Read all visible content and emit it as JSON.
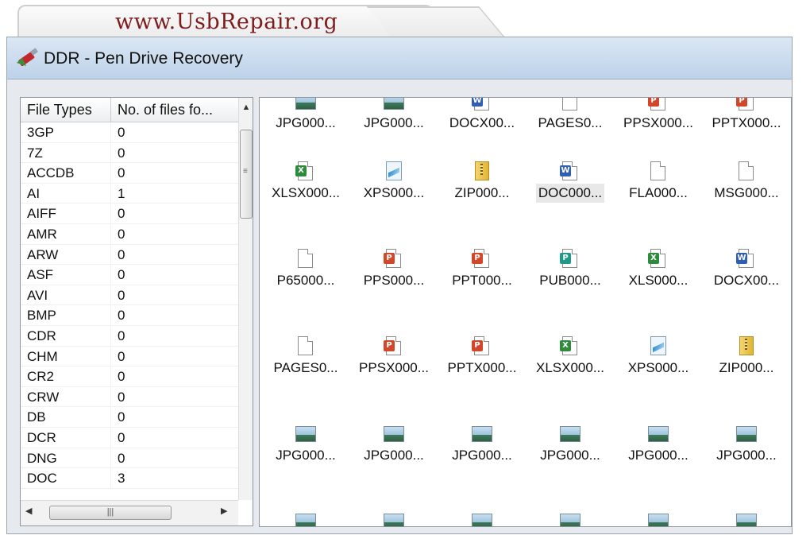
{
  "watermark": "www.UsbRepair.org",
  "window": {
    "title": "DDR - Pen Drive Recovery",
    "icon": "pen-drive-icon"
  },
  "file_types_table": {
    "columns": [
      "File Types",
      "No. of files fo..."
    ],
    "rows": [
      {
        "type": "3GP",
        "count": "0"
      },
      {
        "type": "7Z",
        "count": "0"
      },
      {
        "type": "ACCDB",
        "count": "0"
      },
      {
        "type": "AI",
        "count": "1"
      },
      {
        "type": "AIFF",
        "count": "0"
      },
      {
        "type": "AMR",
        "count": "0"
      },
      {
        "type": "ARW",
        "count": "0"
      },
      {
        "type": "ASF",
        "count": "0"
      },
      {
        "type": "AVI",
        "count": "0"
      },
      {
        "type": "BMP",
        "count": "0"
      },
      {
        "type": "CDR",
        "count": "0"
      },
      {
        "type": "CHM",
        "count": "0"
      },
      {
        "type": "CR2",
        "count": "0"
      },
      {
        "type": "CRW",
        "count": "0"
      },
      {
        "type": "DB",
        "count": "0"
      },
      {
        "type": "DCR",
        "count": "0"
      },
      {
        "type": "DNG",
        "count": "0"
      },
      {
        "type": "DOC",
        "count": "3"
      }
    ]
  },
  "files_view": {
    "rows": [
      [
        {
          "label": "JPG000...",
          "icon": "image-icon"
        },
        {
          "label": "JPG000...",
          "icon": "image-icon"
        },
        {
          "label": "DOCX00...",
          "icon": "word-doc-icon"
        },
        {
          "label": "PAGES0...",
          "icon": "blank-doc-icon"
        },
        {
          "label": "PPSX000...",
          "icon": "powerpoint-show-icon"
        },
        {
          "label": "PPTX000...",
          "icon": "powerpoint-icon"
        }
      ],
      [
        {
          "label": "XLSX000...",
          "icon": "excel-icon"
        },
        {
          "label": "XPS000...",
          "icon": "xps-icon"
        },
        {
          "label": "ZIP000...",
          "icon": "zip-icon"
        },
        {
          "label": "DOC000...",
          "icon": "word-doc-icon",
          "selected": true
        },
        {
          "label": "FLA000...",
          "icon": "blank-doc-icon"
        },
        {
          "label": "MSG000...",
          "icon": "blank-doc-icon"
        }
      ],
      [
        {
          "label": "P65000...",
          "icon": "blank-doc-icon"
        },
        {
          "label": "PPS000...",
          "icon": "powerpoint-show-icon"
        },
        {
          "label": "PPT000...",
          "icon": "powerpoint-icon"
        },
        {
          "label": "PUB000...",
          "icon": "publisher-icon"
        },
        {
          "label": "XLS000...",
          "icon": "excel-icon"
        },
        {
          "label": "DOCX00...",
          "icon": "word-doc-icon"
        }
      ],
      [
        {
          "label": "PAGES0...",
          "icon": "blank-doc-icon"
        },
        {
          "label": "PPSX000...",
          "icon": "powerpoint-show-icon"
        },
        {
          "label": "PPTX000...",
          "icon": "powerpoint-icon"
        },
        {
          "label": "XLSX000...",
          "icon": "excel-icon"
        },
        {
          "label": "XPS000...",
          "icon": "xps-icon"
        },
        {
          "label": "ZIP000...",
          "icon": "zip-icon"
        }
      ],
      [
        {
          "label": "JPG000...",
          "icon": "image-icon"
        },
        {
          "label": "JPG000...",
          "icon": "image-icon"
        },
        {
          "label": "JPG000...",
          "icon": "image-icon"
        },
        {
          "label": "JPG000...",
          "icon": "image-icon"
        },
        {
          "label": "JPG000...",
          "icon": "image-icon"
        },
        {
          "label": "JPG000...",
          "icon": "image-icon"
        }
      ],
      [
        {
          "label": "",
          "icon": "image-icon"
        },
        {
          "label": "",
          "icon": "image-icon"
        },
        {
          "label": "",
          "icon": "image-icon"
        },
        {
          "label": "",
          "icon": "image-icon"
        },
        {
          "label": "",
          "icon": "image-icon"
        },
        {
          "label": "",
          "icon": "image-icon"
        }
      ]
    ]
  },
  "colors": {
    "watermark": "#7d1c1c",
    "titlebar": "#c6d9ee",
    "word": "#2f5eb3",
    "excel": "#2e8b3d",
    "powerpoint": "#d2472a",
    "publisher": "#1f9a8a"
  }
}
